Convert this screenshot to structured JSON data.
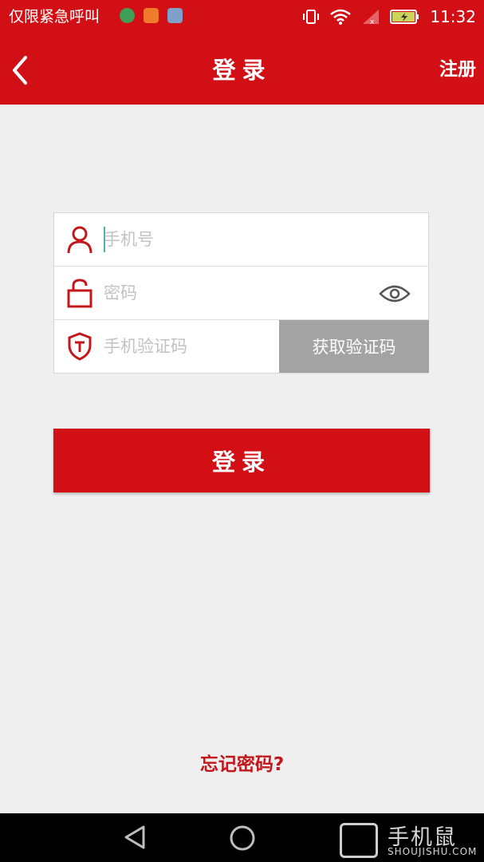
{
  "status_bar": {
    "carrier_text": "仅限紧急呼叫",
    "time": "11:32",
    "notification_icons": [
      "globe-app-icon",
      "heart-app-icon",
      "game-app-icon"
    ],
    "system_icons": [
      "vibrate-icon",
      "wifi-icon",
      "signal-icon",
      "battery-icon"
    ]
  },
  "header": {
    "title": "登录",
    "register_label": "注册",
    "back_icon": "back-arrow-icon",
    "background_color": "#d20f14"
  },
  "form": {
    "phone_placeholder": "手机号",
    "phone_value": "",
    "password_placeholder": "密码",
    "password_value": "",
    "code_placeholder": "手机验证码",
    "code_value": "",
    "get_code_label": "获取验证码"
  },
  "login_button": {
    "label": "登录"
  },
  "forgot_password": {
    "label": "忘记密码?"
  },
  "watermark": {
    "title": "手机鼠",
    "subtitle": "SHOUJISHU.COM"
  },
  "colors": {
    "accent": "#d20f14",
    "page_background": "#efefef",
    "disabled_button": "#a3a3a3"
  }
}
